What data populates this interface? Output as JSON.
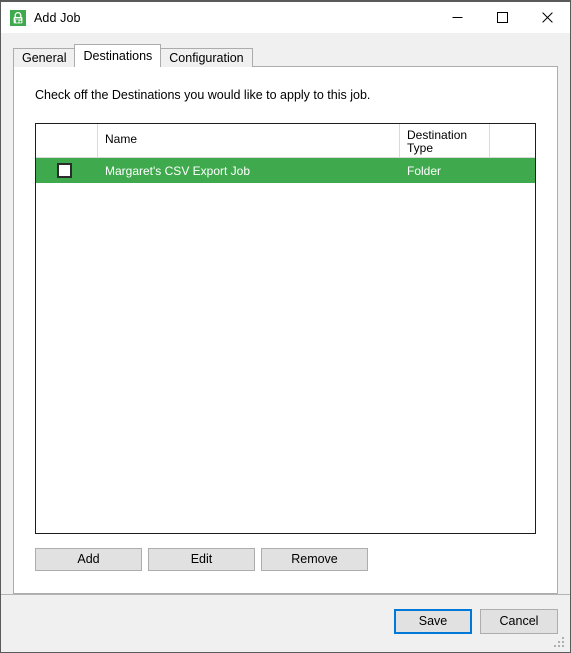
{
  "window": {
    "title": "Add Job",
    "icon": "app-lock-icon",
    "accent_blue": "#0078d7",
    "row_green": "#3faa4d",
    "controls": [
      {
        "name": "minimize",
        "glyph": "minimize-icon"
      },
      {
        "name": "maximize",
        "glyph": "maximize-icon"
      },
      {
        "name": "close",
        "glyph": "close-icon"
      }
    ]
  },
  "tabs": [
    {
      "label": "General",
      "active": false
    },
    {
      "label": "Destinations",
      "active": true
    },
    {
      "label": "Configuration",
      "active": false
    }
  ],
  "panel": {
    "instruction": "Check off the Destinations you would like to apply to this job."
  },
  "grid": {
    "columns": [
      {
        "key": "check",
        "label": ""
      },
      {
        "key": "name",
        "label": "Name"
      },
      {
        "key": "type",
        "label": "Destination Type"
      },
      {
        "key": "last",
        "label": ""
      }
    ],
    "rows": [
      {
        "checked": false,
        "name": "Margaret's CSV Export Job",
        "type": "Folder",
        "selected": true
      }
    ]
  },
  "grid_actions": [
    {
      "label": "Add",
      "name": "add-button"
    },
    {
      "label": "Edit",
      "name": "edit-button"
    },
    {
      "label": "Remove",
      "name": "remove-button"
    }
  ],
  "footer": {
    "save_label": "Save",
    "cancel_label": "Cancel"
  }
}
